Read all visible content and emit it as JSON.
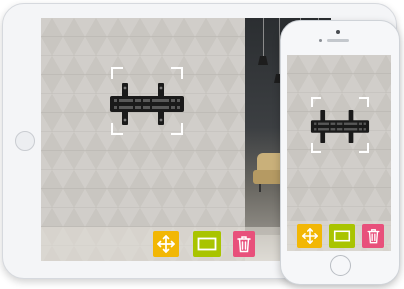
{
  "toolbar": {
    "buttons": [
      {
        "action": "move",
        "icon": "move-arrows-icon",
        "color": "#f2b705"
      },
      {
        "action": "resize",
        "icon": "resize-rectangle-icon",
        "color": "#a9c400"
      },
      {
        "action": "delete",
        "icon": "trash-icon",
        "color": "#e8507b"
      }
    ]
  },
  "colors": {
    "selection_corners": "#ffffff",
    "mount": "#1a1a1a"
  }
}
